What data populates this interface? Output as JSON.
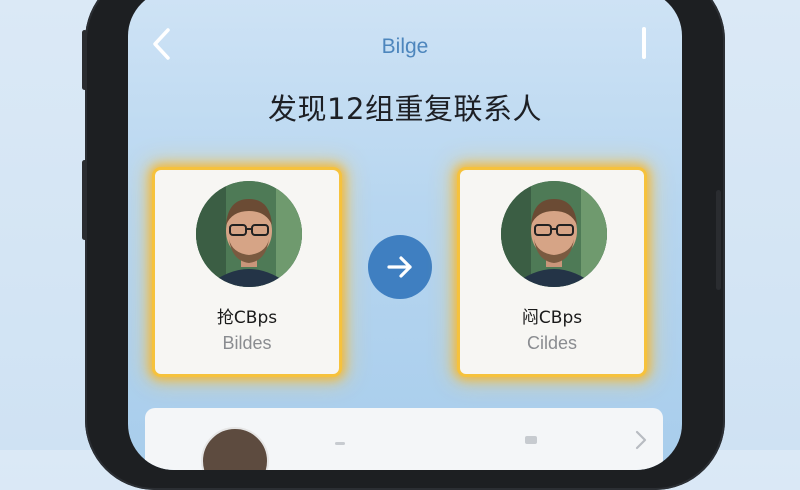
{
  "nav": {
    "title": "Bilge",
    "back_icon": "chevron-left-icon",
    "menu_icon": "vertical-bar-icon"
  },
  "headline": "发现12组重复联系人",
  "cards": [
    {
      "name": "抢CBps",
      "subtitle": "Bildes"
    },
    {
      "name": "闷CBps",
      "subtitle": "Cildes"
    }
  ],
  "merge_icon": "arrow-right-icon",
  "colors": {
    "accent": "#3f7fc1",
    "title_blue": "#4d86bd",
    "highlight_glow": "#f6c23c",
    "card_bg": "#f7f6f3"
  }
}
